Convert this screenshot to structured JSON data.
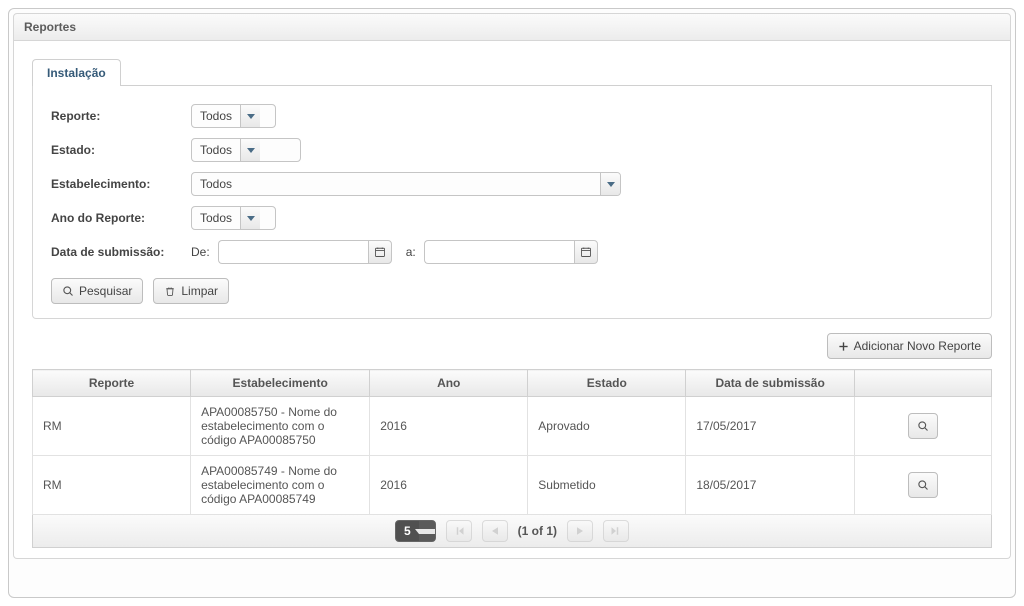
{
  "panel": {
    "title": "Reportes"
  },
  "tabs": {
    "items": [
      {
        "label": "Instalação"
      }
    ]
  },
  "filters": {
    "reporte_label": "Reporte:",
    "reporte_value": "Todos",
    "estado_label": "Estado:",
    "estado_value": "Todos",
    "estab_label": "Estabelecimento:",
    "estab_value": "Todos",
    "ano_label": "Ano do Reporte:",
    "ano_value": "Todos",
    "data_sub_label": "Data de submissão:",
    "de_label": "De:",
    "a_label": "a:",
    "de_value": "",
    "a_value": "",
    "pesquisar_label": "Pesquisar",
    "limpar_label": "Limpar"
  },
  "actions": {
    "add_report_label": "Adicionar Novo Reporte"
  },
  "table": {
    "headers": {
      "reporte": "Reporte",
      "estabelecimento": "Estabelecimento",
      "ano": "Ano",
      "estado": "Estado",
      "data_sub": "Data de submissão",
      "actions": ""
    },
    "rows": [
      {
        "reporte": "RM",
        "estab": "APA00085750 - Nome do estabelecimento com o código APA00085750",
        "ano": "2016",
        "estado": "Aprovado",
        "data": "17/05/2017"
      },
      {
        "reporte": "RM",
        "estab": "APA00085749 - Nome do estabelecimento com o código APA00085749",
        "ano": "2016",
        "estado": "Submetido",
        "data": "18/05/2017"
      }
    ]
  },
  "paginator": {
    "page_size": "5",
    "position": "(1 of 1)"
  }
}
